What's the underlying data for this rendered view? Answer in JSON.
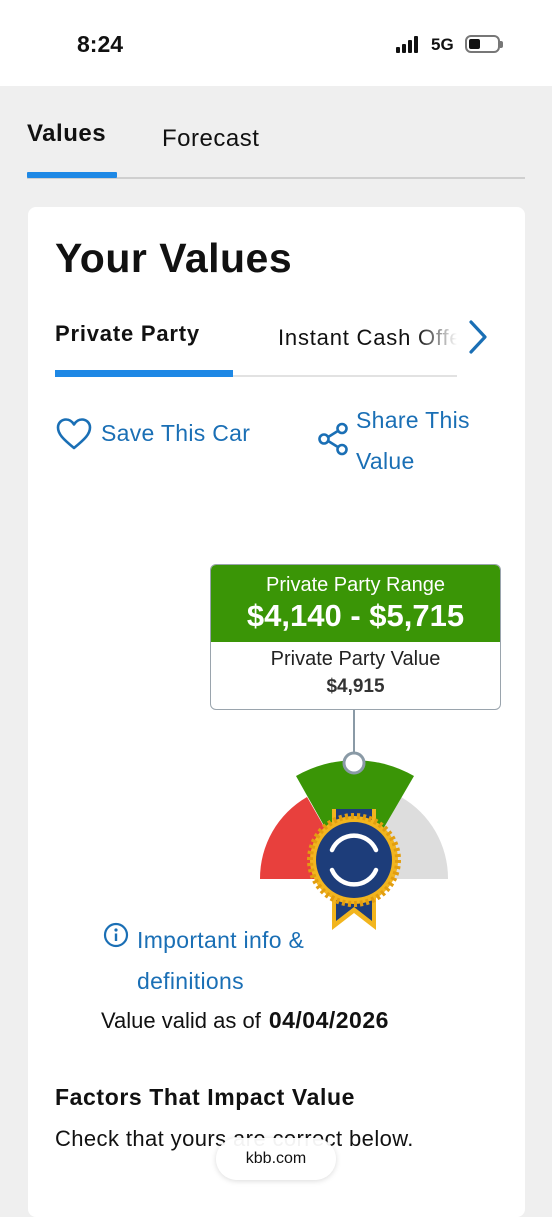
{
  "status_bar": {
    "time": "8:24",
    "network": "5G"
  },
  "nav_tabs": [
    {
      "label": "Values",
      "active": true
    },
    {
      "label": "Forecast",
      "active": false
    }
  ],
  "card": {
    "title": "Your Values",
    "value_tabs": [
      {
        "label": "Private Party",
        "active": true
      },
      {
        "label": "Instant Cash Offer",
        "active": false
      }
    ],
    "actions": {
      "save": "Save This Car",
      "share": "Share This Value"
    },
    "range": {
      "label": "Private Party Range",
      "value": "$4,140 - $5,715",
      "value_label": "Private Party Value",
      "value_amount": "$4,915"
    },
    "info_link": "Important info & definitions",
    "valid": {
      "label": "Value valid as of",
      "date": "04/04/2026"
    },
    "factors": {
      "title": "Factors That Impact Value",
      "text": "Check that yours are correct below."
    }
  },
  "url": "kbb.com",
  "colors": {
    "accent_blue": "#1e88e5",
    "link_blue": "#1a6fb5",
    "range_green": "#3a9506",
    "gauge_red": "#e8403d",
    "gauge_gray": "#dddddd",
    "badge_navy": "#1d3d7a",
    "badge_gold": "#f2b51e"
  },
  "gauge": {
    "position": "center-green-band"
  }
}
